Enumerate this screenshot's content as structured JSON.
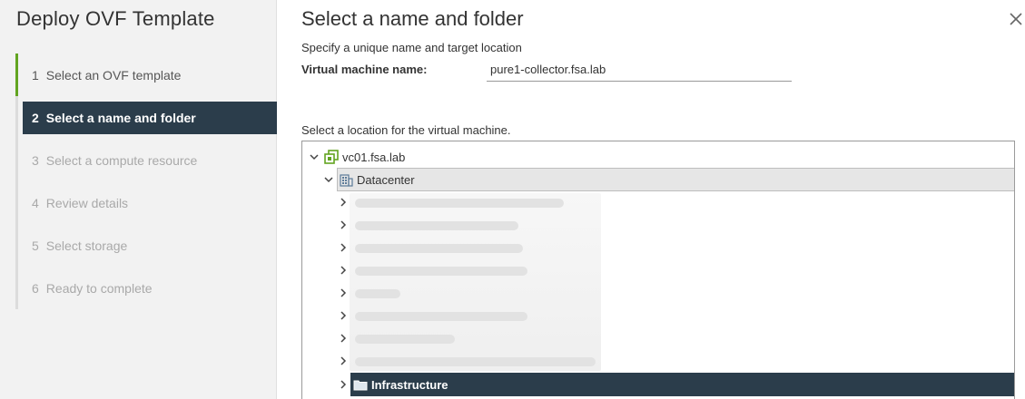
{
  "wizard": {
    "title": "Deploy OVF Template",
    "steps": [
      {
        "num": "1",
        "label": "Select an OVF template",
        "state": "done"
      },
      {
        "num": "2",
        "label": "Select a name and folder",
        "state": "active"
      },
      {
        "num": "3",
        "label": "Select a compute resource",
        "state": "disabled"
      },
      {
        "num": "4",
        "label": "Review details",
        "state": "disabled"
      },
      {
        "num": "5",
        "label": "Select storage",
        "state": "disabled"
      },
      {
        "num": "6",
        "label": "Ready to complete",
        "state": "disabled"
      }
    ]
  },
  "main": {
    "title": "Select a name and folder",
    "subtitle": "Specify a unique name and target location",
    "vm_name_label": "Virtual machine name:",
    "vm_name_value": "pure1-collector.fsa.lab",
    "location_label": "Select a location for the virtual machine."
  },
  "tree": {
    "root": {
      "label": "vc01.fsa.lab",
      "icon": "vcenter-icon"
    },
    "datacenter": {
      "label": "Datacenter",
      "icon": "datacenter-icon"
    },
    "folder_selected": {
      "label": "Infrastructure",
      "icon": "folder-icon"
    }
  },
  "colors": {
    "selected_bg": "#2b3d4b",
    "done_bar": "#62a420",
    "panel_bg": "#f2f2f2"
  }
}
